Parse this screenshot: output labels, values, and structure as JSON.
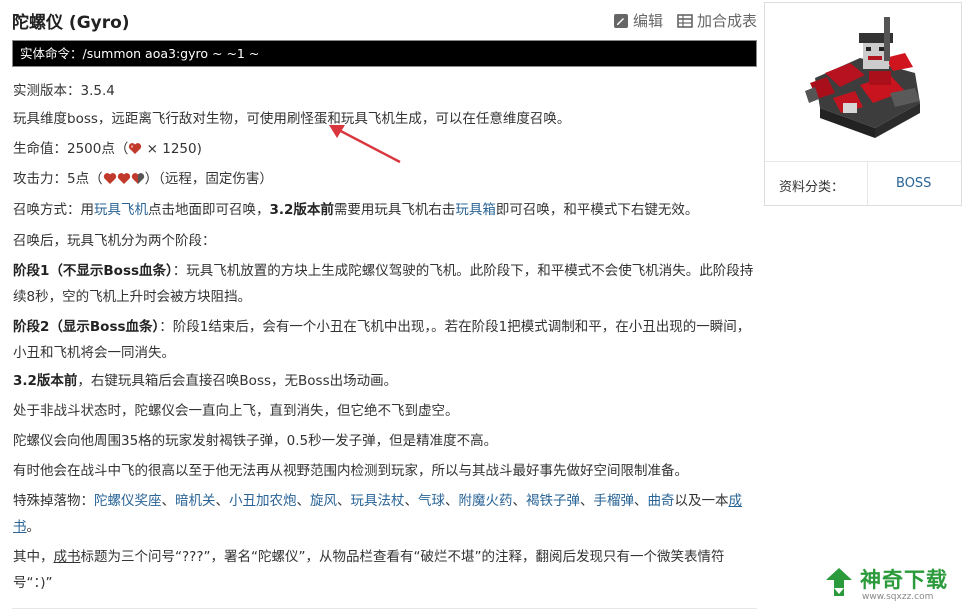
{
  "header": {
    "title": "陀螺仪 (Gyro)",
    "edit_label": "编辑",
    "craft_table_label": "加合成表"
  },
  "command": "实体命令：/summon aoa3:gyro ~ ~1 ~",
  "content": {
    "version": "实测版本：3.5.4",
    "intro": "玩具维度boss，远距离飞行敌对生物，可使用刷怪蛋和玩具飞机生成，可以在任意维度召唤。",
    "health_prefix": "生命值：2500点（",
    "health_suffix": " × 1250)",
    "attack_prefix": "攻击力：5点（",
    "attack_suffix": "）（远程，固定伤害）",
    "summon": {
      "t1": "召唤方式：用",
      "link1": "玩具飞机",
      "t2": "点击地面即可召唤，",
      "bold": "3.2版本前",
      "t3": "需要用玩具飞机右击",
      "link2": "玩具箱",
      "t4": "即可召唤，和平模式下右键无效。"
    },
    "after_summon": "召唤后，玩具飞机分为两个阶段：",
    "stage1": {
      "label": "阶段1（不显示Boss血条）",
      "text": "：玩具飞机放置的方块上生成陀螺仪驾驶的飞机。此阶段下，和平模式不会使飞机消失。此阶段持续8秒，空的飞机上升时会被方块阻挡。"
    },
    "stage2": {
      "label": "阶段2（显示Boss血条）",
      "text": "：阶段1结束后，会有一个小丑在飞机中出现，。若在阶段1把模式调制和平，在小丑出现的一瞬间，小丑和飞机将会一同消失。"
    },
    "v32": {
      "bold": "3.2版本前",
      "text": "，右键玩具箱后会直接召唤Boss，无Boss出场动画。"
    },
    "nonbattle": "处于非战斗状态时，陀螺仪会一直向上飞，直到消失，但它绝不飞到虚空。",
    "attack_desc": "陀螺仪会向他周围35格的玩家发射褐铁子弹，0.5秒一发子弹，但是精准度不高。",
    "fly_high": "有时他会在战斗中飞的很高以至于他无法再从视野范围内检测到玩家，所以与其战斗最好事先做好空间限制准备。",
    "drops": {
      "prefix": "特殊掉落物：",
      "items": [
        "陀螺仪奖座",
        "暗机关",
        "小丑加农炮",
        "旋风",
        "玩具法杖",
        "气球",
        "附魔火药",
        "褐铁子弹",
        "手榴弹",
        "曲奇"
      ],
      "sep": "、",
      "mid": "以及一本",
      "last": "成书",
      "end": "。"
    },
    "book": {
      "t1": "其中，",
      "link": "成书",
      "t2": "标题为三个问号“???”，署名“陀螺仪”，从物品栏查看有“破烂不堪”的注释，翻阅后发现只有一个微笑表情符号“：)”"
    }
  },
  "infobox": {
    "label": "资料分类：",
    "value": "BOSS"
  },
  "watermark": {
    "text": "神奇下载",
    "url": "www.sqxzz.com"
  },
  "colors": {
    "link": "#2a6496",
    "heart": "#c0392b",
    "arrow": "#d9363e",
    "watermark": "#2a9a3a",
    "command_bg": "#000000"
  }
}
